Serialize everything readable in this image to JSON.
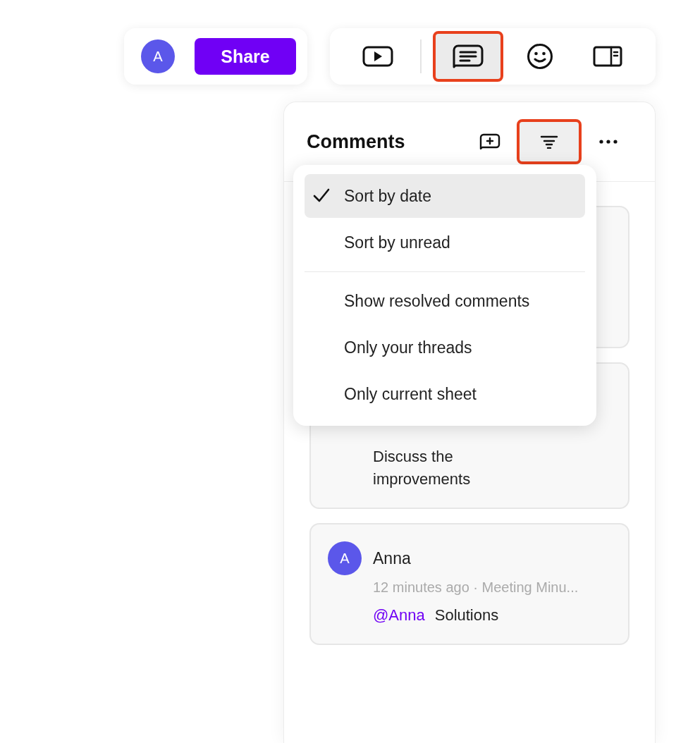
{
  "toolbar": {
    "avatar": "A",
    "share": "Share",
    "tools": [
      {
        "kind": "present",
        "selected": false,
        "annotated": false
      },
      {
        "kind": "comments",
        "selected": true,
        "annotated": true
      },
      {
        "kind": "emoji",
        "selected": false,
        "annotated": false
      },
      {
        "kind": "sidebar",
        "selected": false,
        "annotated": false
      }
    ]
  },
  "comments": {
    "title": "Comments",
    "actions": [
      {
        "kind": "add",
        "selected": false,
        "annotated": false
      },
      {
        "kind": "filter",
        "selected": true,
        "annotated": true
      },
      {
        "kind": "more",
        "selected": false,
        "annotated": false
      }
    ],
    "menu": {
      "groups": [
        [
          {
            "label": "Sort by date",
            "checked": true,
            "selected": true
          },
          {
            "label": "Sort by unread",
            "checked": false,
            "selected": false
          }
        ],
        [
          {
            "label": "Show resolved comments",
            "checked": false,
            "selected": false
          },
          {
            "label": "Only your threads",
            "checked": false,
            "selected": false
          },
          {
            "label": "Only current sheet",
            "checked": false,
            "selected": false
          }
        ]
      ]
    },
    "cards": [
      {
        "kind": "covered"
      },
      {
        "kind": "partial",
        "body": "Discuss the improvements"
      },
      {
        "kind": "full",
        "avatar": "A",
        "author": "Anna",
        "meta": "12 minutes ago · Meeting Minu...",
        "mention": "@Anna",
        "body": "Solutions"
      }
    ]
  }
}
